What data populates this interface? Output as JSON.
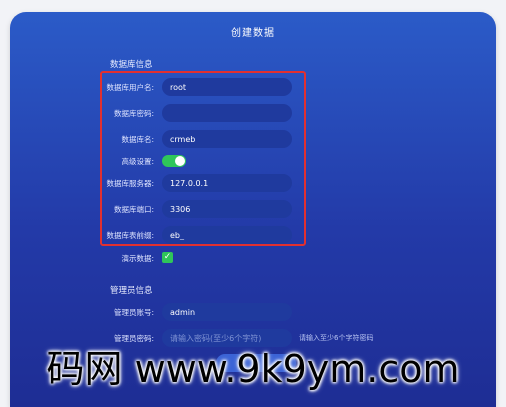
{
  "window": {
    "title": "创建数据"
  },
  "db_section": {
    "title": "数据库信息",
    "fields": [
      {
        "label": "数据库用户名:",
        "value": "root"
      },
      {
        "label": "数据库密码:",
        "value": ""
      },
      {
        "label": "数据库名:",
        "value": "crmeb"
      }
    ],
    "advanced_label": "高级设置:",
    "advanced_enabled": true,
    "advanced_fields": [
      {
        "label": "数据库服务器:",
        "value": "127.0.0.1"
      },
      {
        "label": "数据库端口:",
        "value": "3306"
      },
      {
        "label": "数据库表前缀:",
        "value": "eb_"
      }
    ],
    "demo_label": "演示数据:",
    "demo_checked": true
  },
  "admin_section": {
    "title": "管理员信息",
    "account_label": "管理员账号:",
    "account_value": "admin",
    "password_label": "管理员密码:",
    "password_placeholder": "请输入密码(至少6个字符)",
    "password_hint": "请输入至少6个字符密码"
  },
  "watermark": "码网 www.9k9ym.com",
  "colors": {
    "accent": "#2fc65a",
    "highlight": "#e23030",
    "panel": "#233aa8"
  }
}
